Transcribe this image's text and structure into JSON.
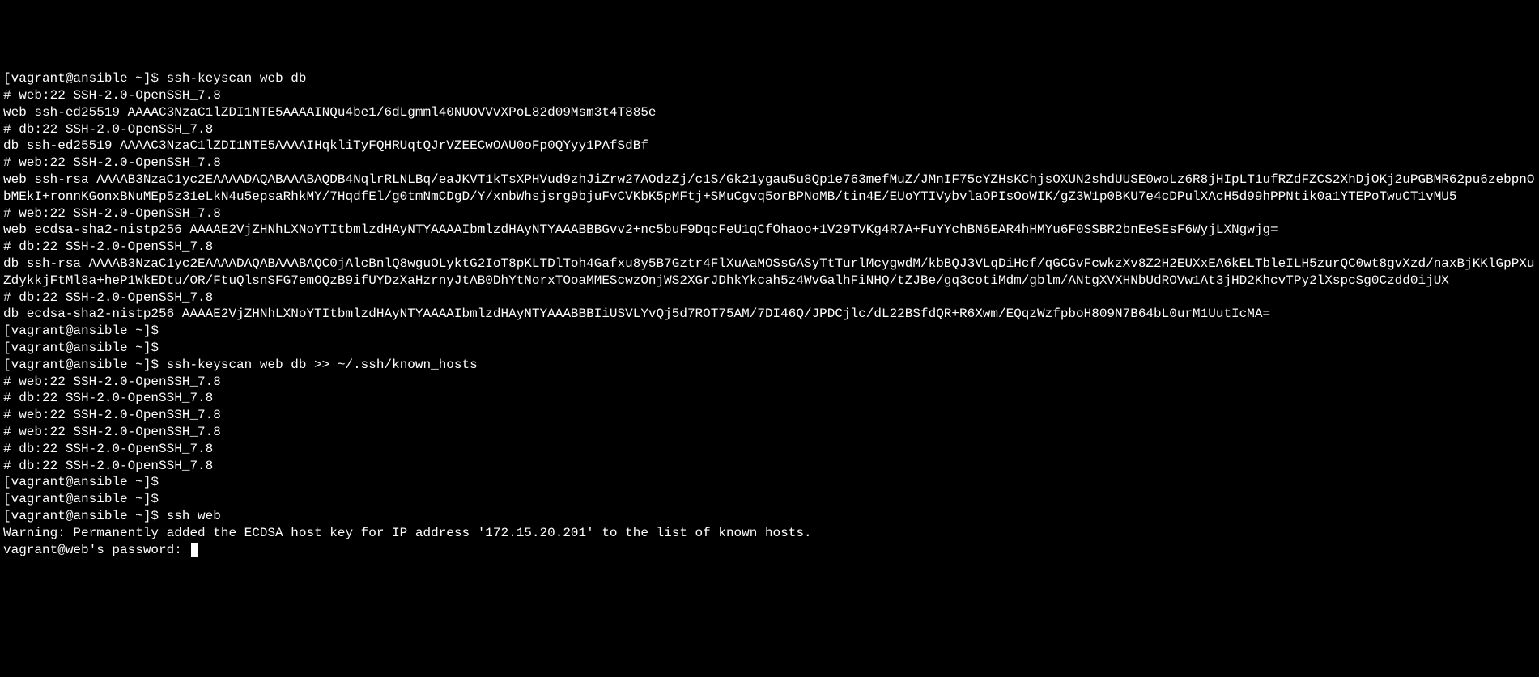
{
  "terminal": {
    "lines": [
      {
        "prompt": "[vagrant@ansible ~]$ ",
        "command": "ssh-keyscan web db"
      },
      {
        "text": "# web:22 SSH-2.0-OpenSSH_7.8"
      },
      {
        "text": "web ssh-ed25519 AAAAC3NzaC1lZDI1NTE5AAAAINQu4be1/6dLgmml40NUOVVvXPoL82d09Msm3t4T885e"
      },
      {
        "text": "# db:22 SSH-2.0-OpenSSH_7.8"
      },
      {
        "text": "db ssh-ed25519 AAAAC3NzaC1lZDI1NTE5AAAAIHqkliTyFQHRUqtQJrVZEECwOAU0oFp0QYyy1PAfSdBf"
      },
      {
        "text": "# web:22 SSH-2.0-OpenSSH_7.8"
      },
      {
        "text": "web ssh-rsa AAAAB3NzaC1yc2EAAAADAQABAAABAQDB4NqlrRLNLBq/eaJKVT1kTsXPHVud9zhJiZrw27AOdzZj/c1S/Gk21ygau5u8Qp1e763mefMuZ/JMnIF75cYZHsKChjsOXUN2shdUUSE0woLz6R8jHIpLT1ufRZdFZCS2XhDjOKj2uPGBMR62pu6zebpnObMEkI+ronnKGonxBNuMEp5z31eLkN4u5epsaRhkMY/7HqdfEl/g0tmNmCDgD/Y/xnbWhsjsrg9bjuFvCVKbK5pMFtj+SMuCgvq5orBPNoMB/tin4E/EUoYTIVybvlaOPIsOoWIK/gZ3W1p0BKU7e4cDPulXAcH5d99hPPNtik0a1YTEPoTwuCT1vMU5"
      },
      {
        "text": "# web:22 SSH-2.0-OpenSSH_7.8"
      },
      {
        "text": "web ecdsa-sha2-nistp256 AAAAE2VjZHNhLXNoYTItbmlzdHAyNTYAAAAIbmlzdHAyNTYAAABBBGvv2+nc5buF9DqcFeU1qCfOhaoo+1V29TVKg4R7A+FuYYchBN6EAR4hHMYu6F0SSBR2bnEeSEsF6WyjLXNgwjg="
      },
      {
        "text": "# db:22 SSH-2.0-OpenSSH_7.8"
      },
      {
        "text": "db ssh-rsa AAAAB3NzaC1yc2EAAAADAQABAAABAQC0jAlcBnlQ8wguOLyktG2IoT8pKLTDlToh4Gafxu8y5B7Gztr4FlXuAaMOSsGASyTtTurlMcygwdM/kbBQJ3VLqDiHcf/qGCGvFcwkzXv8Z2H2EUXxEA6kELTbleILH5zurQC0wt8gvXzd/naxBjKKlGpPXuZdykkjFtMl8a+heP1WkEDtu/OR/FtuQlsnSFG7emOQzB9ifUYDzXaHzrnyJtAB0DhYtNorxTOoaMMEScwzOnjWS2XGrJDhkYkcah5z4WvGalhFiNHQ/tZJBe/gq3cotiMdm/gblm/ANtgXVXHNbUdROVw1At3jHD2KhcvTPy2lXspcSg0Czdd0ijUX"
      },
      {
        "text": "# db:22 SSH-2.0-OpenSSH_7.8"
      },
      {
        "text": "db ecdsa-sha2-nistp256 AAAAE2VjZHNhLXNoYTItbmlzdHAyNTYAAAAIbmlzdHAyNTYAAABBBIiUSVLYvQj5d7ROT75AM/7DI46Q/JPDCjlc/dL22BSfdQR+R6Xwm/EQqzWzfpboH809N7B64bL0urM1UutIcMA="
      },
      {
        "prompt": "[vagrant@ansible ~]$ ",
        "command": ""
      },
      {
        "prompt": "[vagrant@ansible ~]$ ",
        "command": ""
      },
      {
        "prompt": "[vagrant@ansible ~]$ ",
        "command": "ssh-keyscan web db >> ~/.ssh/known_hosts"
      },
      {
        "text": "# web:22 SSH-2.0-OpenSSH_7.8"
      },
      {
        "text": "# db:22 SSH-2.0-OpenSSH_7.8"
      },
      {
        "text": "# web:22 SSH-2.0-OpenSSH_7.8"
      },
      {
        "text": "# web:22 SSH-2.0-OpenSSH_7.8"
      },
      {
        "text": "# db:22 SSH-2.0-OpenSSH_7.8"
      },
      {
        "text": "# db:22 SSH-2.0-OpenSSH_7.8"
      },
      {
        "prompt": "[vagrant@ansible ~]$ ",
        "command": ""
      },
      {
        "prompt": "[vagrant@ansible ~]$ ",
        "command": ""
      },
      {
        "prompt": "[vagrant@ansible ~]$ ",
        "command": "ssh web"
      },
      {
        "text": "Warning: Permanently added the ECDSA host key for IP address '172.15.20.201' to the list of known hosts."
      },
      {
        "text": "vagrant@web's password: ",
        "cursor": true
      }
    ]
  }
}
